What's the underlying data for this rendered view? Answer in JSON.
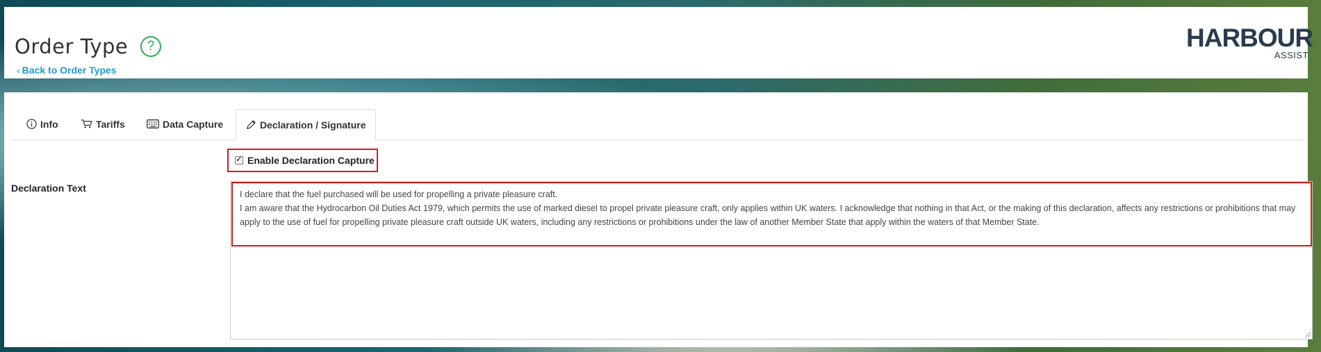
{
  "header": {
    "title": "Order Type",
    "help_icon": "question-circle-icon",
    "back_link": "Back to Order Types",
    "logo": {
      "word": "HARBOUR",
      "sub": "ASSIST"
    }
  },
  "tabs": [
    {
      "label": "Info",
      "icon": "info-icon"
    },
    {
      "label": "Tariffs",
      "icon": "cart-icon"
    },
    {
      "label": "Data Capture",
      "icon": "keyboard-icon"
    },
    {
      "label": "Declaration / Signature",
      "icon": "pen-icon",
      "active": true
    }
  ],
  "form": {
    "enable_label": "Enable Declaration Capture",
    "enable_checked": true,
    "declaration_label": "Declaration Text",
    "declaration_lines": [
      "I declare that the fuel purchased will be used for propelling a private pleasure craft.",
      "I am aware that the Hydrocarbon Oil Duties Act 1979, which permits the use of marked diesel to propel private pleasure craft, only applies within UK waters. I acknowledge that nothing in that Act, or the making of this declaration, affects any restrictions or prohibitions that may apply to the use of fuel for propelling private pleasure craft outside UK waters, including any restrictions or prohibitions under the law of another Member State that apply within the waters of that Member State."
    ]
  },
  "colors": {
    "accent_green": "#28b04a",
    "link_blue": "#1e9bd7",
    "highlight_red": "#d81a1a"
  }
}
